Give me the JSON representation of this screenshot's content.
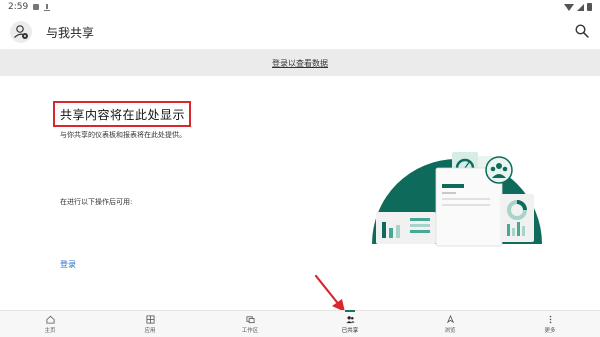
{
  "status_bar": {
    "time": "2:59"
  },
  "app_bar": {
    "title": "与我共享"
  },
  "banner": {
    "link_text": "登录以查看数据"
  },
  "content": {
    "title": "共享内容将在此处显示",
    "description": "与你共享的仪表板和报表将在此处提供。",
    "actions_label": "在进行以下操作后可用:",
    "signin_link": "登录"
  },
  "bottom_nav": {
    "items": [
      {
        "label": "主页",
        "icon": "home-icon"
      },
      {
        "label": "应用",
        "icon": "apps-icon"
      },
      {
        "label": "工作区",
        "icon": "workspaces-icon"
      },
      {
        "label": "已共享",
        "icon": "shared-icon",
        "active": true
      },
      {
        "label": "浏览",
        "icon": "browse-icon"
      },
      {
        "label": "更多",
        "icon": "more-icon"
      }
    ]
  },
  "colors": {
    "accent": "#0e7a6a",
    "highlight_box": "#d9272e",
    "link": "#1f6fd1",
    "illustration_green": "#0e6b5c"
  }
}
